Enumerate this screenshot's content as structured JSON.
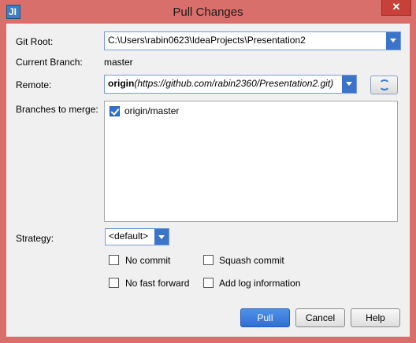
{
  "window": {
    "title": "Pull Changes",
    "icon_text": "JI",
    "close_glyph": "✕"
  },
  "git_root": {
    "label": "Git Root:",
    "value": "C:\\Users\\rabin0623\\IdeaProjects\\Presentation2"
  },
  "current_branch": {
    "label": "Current Branch:",
    "value": "master"
  },
  "remote": {
    "label": "Remote:",
    "name": "origin",
    "url": "(https://github.com/rabin2360/Presentation2.git)"
  },
  "branches": {
    "label": "Branches to merge:",
    "items": [
      {
        "label": "origin/master",
        "checked": true
      }
    ]
  },
  "strategy": {
    "label": "Strategy:",
    "value": "<default>"
  },
  "options": {
    "no_commit": "No commit",
    "squash_commit": "Squash commit",
    "no_fast_forward": "No fast forward",
    "add_log_information": "Add log information"
  },
  "buttons": {
    "pull": "Pull",
    "cancel": "Cancel",
    "help": "Help"
  },
  "colors": {
    "frame": "#d96f6b",
    "accent": "#2f6fd6"
  }
}
